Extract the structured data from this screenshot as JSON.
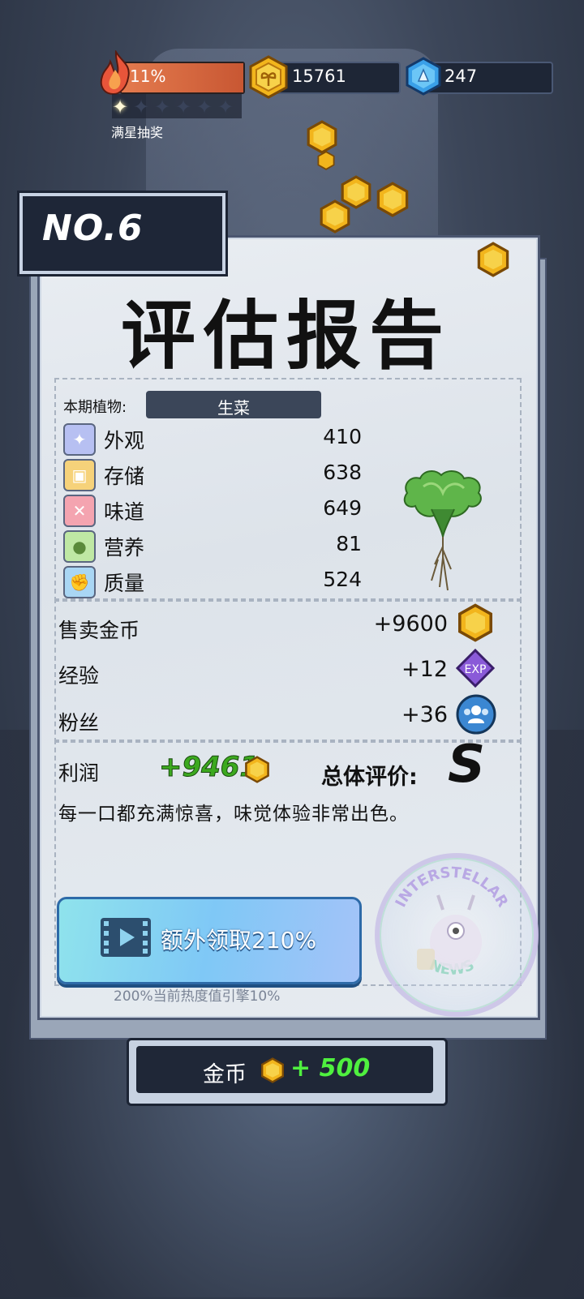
{
  "hud": {
    "progress_pct_text": "11%",
    "progress_value": 0.11,
    "stars_total": 6,
    "stars_lit": 1,
    "stars_label": "满星抽奖",
    "coins": "15761",
    "gems": "247"
  },
  "report": {
    "number": "NO.6",
    "title": "评估报告",
    "plant_label": "本期植物:",
    "plant_name": "生菜",
    "stats": [
      {
        "name": "外观",
        "value": "410",
        "icon": "sparkle-icon",
        "color": "#9aa6e8"
      },
      {
        "name": "存储",
        "value": "638",
        "icon": "box-icon",
        "color": "#f2c45a"
      },
      {
        "name": "味道",
        "value": "649",
        "icon": "fork-knife-icon",
        "color": "#f08a9a"
      },
      {
        "name": "营养",
        "value": "81",
        "icon": "fruit-icon",
        "color": "#a8e08a"
      },
      {
        "name": "质量",
        "value": "524",
        "icon": "muscle-icon",
        "color": "#8ec8f0"
      }
    ],
    "rewards": {
      "sell_label": "售卖金币",
      "sell_value": "+9600",
      "exp_label": "经验",
      "exp_value": "+12",
      "exp_icon_text": "EXP",
      "fans_label": "粉丝",
      "fans_value": "+36"
    },
    "profit_label": "利润",
    "profit_value": "+9461",
    "overall_label": "总体评价:",
    "grade": "S",
    "comment": "每一口都充满惊喜，味觉体验非常出色。",
    "extra_button": "额外领取210%",
    "extra_note": "200%当前热度值引擎10%",
    "stamp_text_top": "INTERSTELLAR",
    "stamp_text_bottom": "NEWS"
  },
  "footer": {
    "gold_label": "金币",
    "gold_plus": "+ 500"
  },
  "colors": {
    "accent_green": "#3ca91f",
    "coin_gold": "#f2b51c",
    "gem_blue": "#3aa0e8",
    "panel_dark": "#1f2737"
  }
}
